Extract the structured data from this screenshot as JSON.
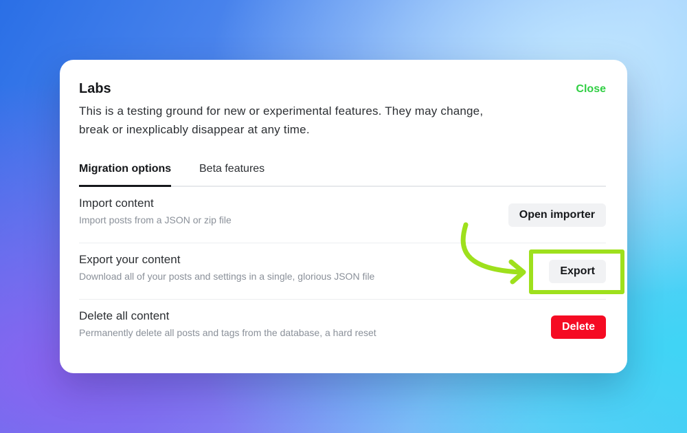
{
  "dialog": {
    "title": "Labs",
    "close_label": "Close",
    "description": "This is a testing ground for new or experimental features. They may change, break or inexplicably disappear at any time."
  },
  "tabs": [
    {
      "label": "Migration options",
      "active": true
    },
    {
      "label": "Beta features",
      "active": false
    }
  ],
  "rows": [
    {
      "title": "Import content",
      "description": "Import posts from a JSON or zip file",
      "button": "Open importer"
    },
    {
      "title": "Export your content",
      "description": "Download all of your posts and settings in a single, glorious JSON file",
      "button": "Export"
    },
    {
      "title": "Delete all content",
      "description": "Permanently delete all posts and tags from the database, a hard reset",
      "button": "Delete"
    }
  ],
  "colors": {
    "accent": "#30cf43",
    "danger": "#f50b23",
    "highlight": "#9ee01c"
  }
}
